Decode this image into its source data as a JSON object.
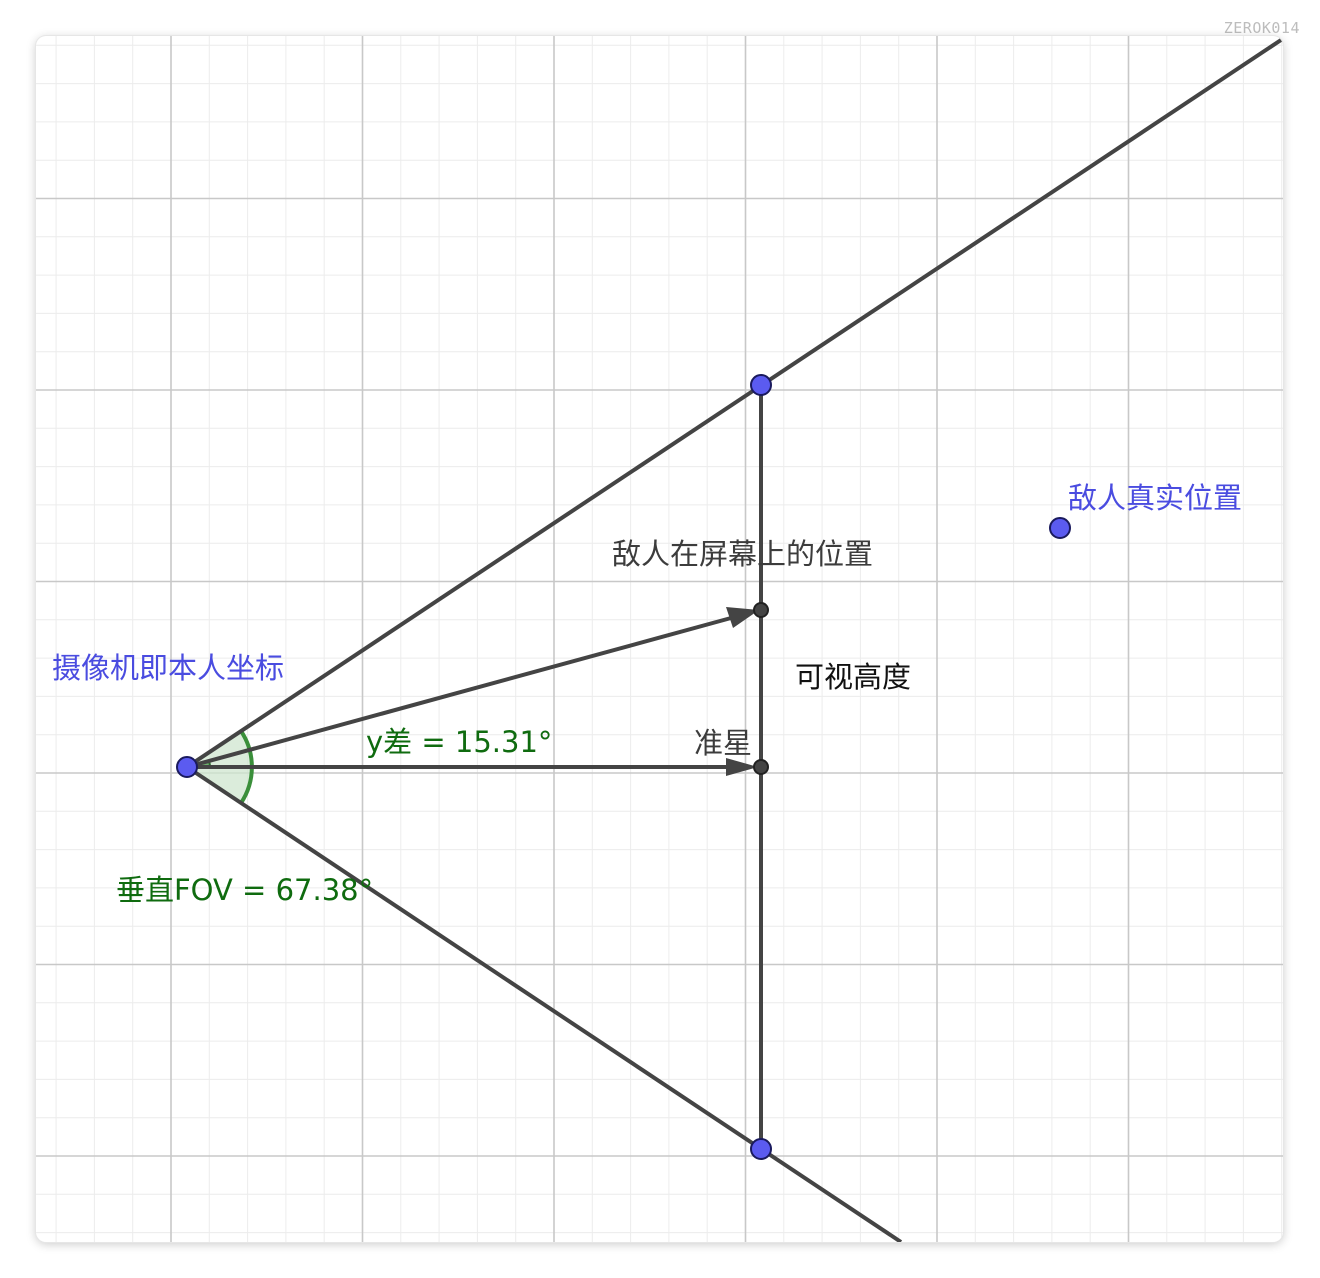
{
  "watermark": "ZEROK014",
  "labels": {
    "camera": "摄像机即本人坐标",
    "enemy_real": "敌人真实位置",
    "enemy_screen": "敌人在屏幕上的位置",
    "visible_height": "可视高度",
    "crosshair": "准星"
  },
  "angles": {
    "y_diff": "y差 = 15.31°",
    "vertical_fov": "垂直FOV = 67.38°"
  },
  "colors": {
    "point_fill": "#5b5bf0",
    "point_stroke": "#1a1a5e",
    "line": "#444444",
    "angle_fill": "#cfe6cf",
    "angle_stroke": "#3a8f3a",
    "grid_major": "#c8c8c8",
    "grid_minor": "#ececec"
  }
}
